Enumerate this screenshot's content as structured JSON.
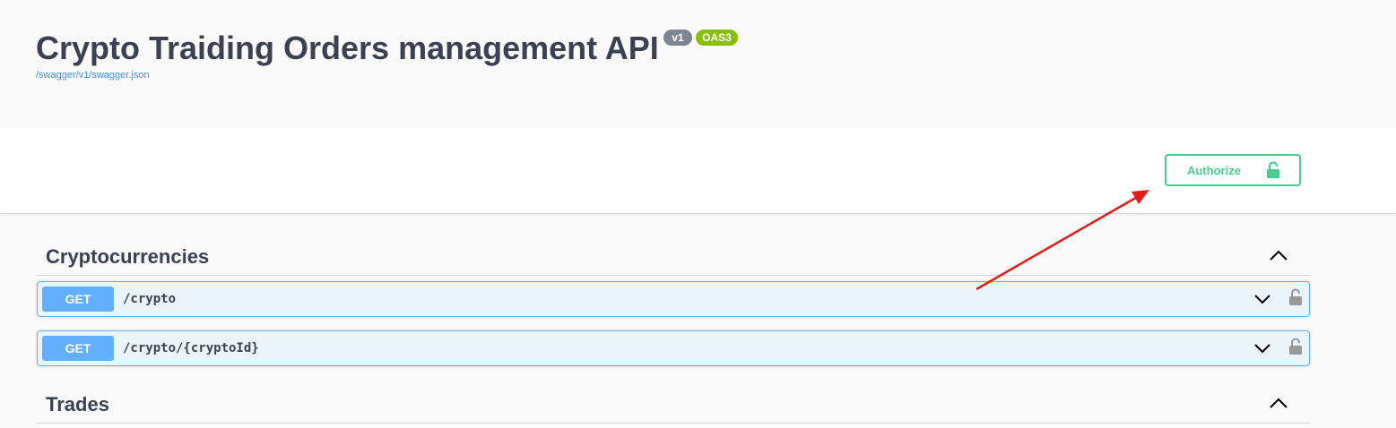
{
  "info": {
    "title": "Crypto Traiding Orders management API",
    "version_badge": "v1",
    "oas_badge": "OAS3",
    "spec_link": "/swagger/v1/swagger.json"
  },
  "authorize": {
    "label": "Authorize",
    "icon": "unlocked-padlock-icon"
  },
  "tags": [
    {
      "name": "Cryptocurrencies",
      "expanded": true,
      "operations": [
        {
          "method": "GET",
          "path": "/crypto"
        },
        {
          "method": "GET",
          "path": "/crypto/{cryptoId}"
        }
      ]
    },
    {
      "name": "Trades",
      "expanded": true,
      "operations": []
    }
  ],
  "colors": {
    "get_method": "#61affe",
    "authorize": "#49cc90",
    "annotation_arrow": "#e31b1b"
  }
}
